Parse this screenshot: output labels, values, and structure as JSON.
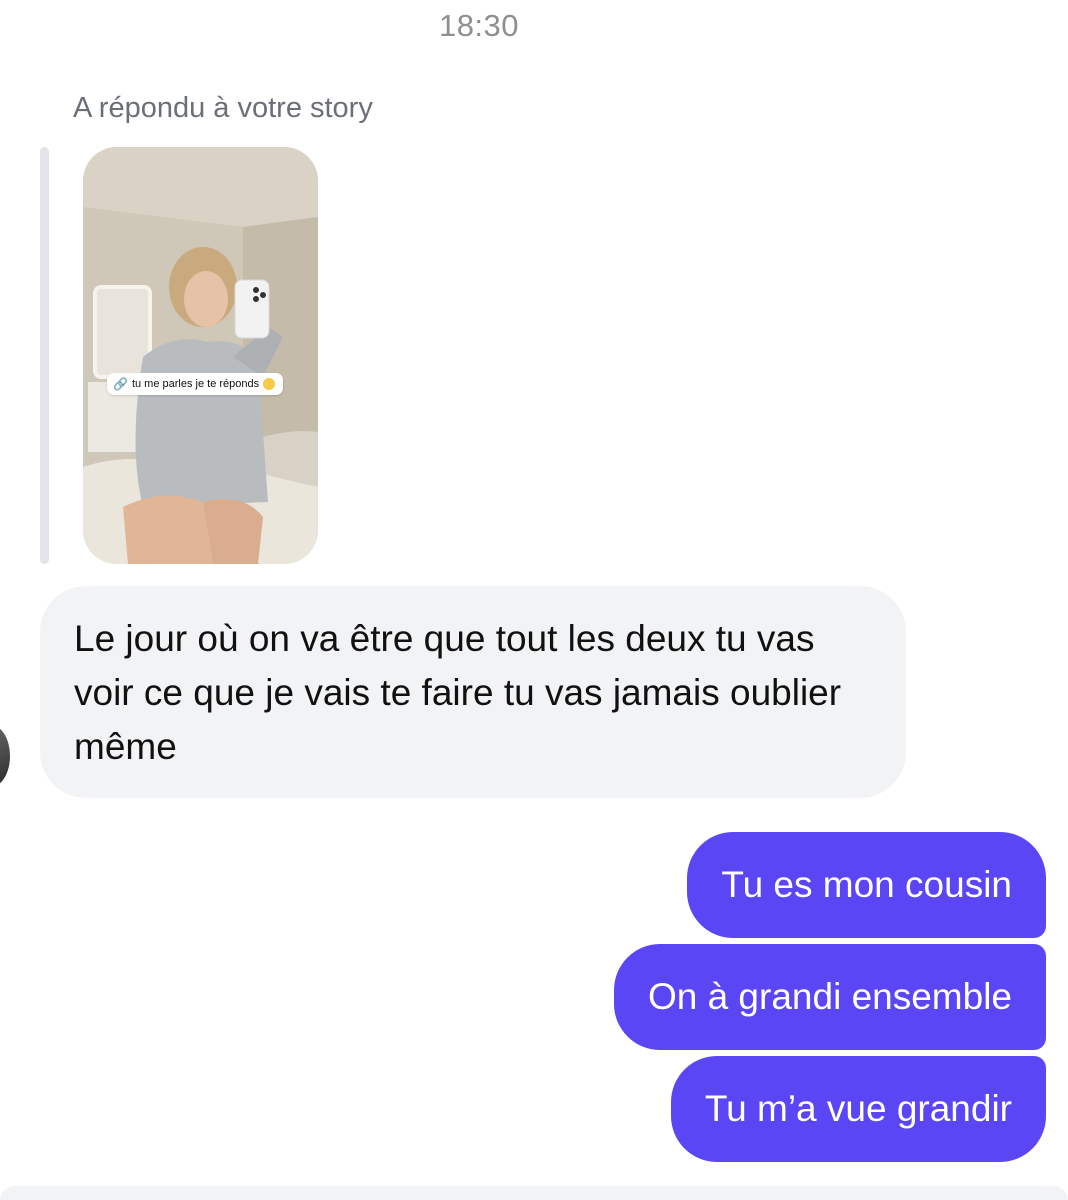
{
  "chat": {
    "timestamp": "18:30",
    "story_reply_note": "A répondu à votre story",
    "story": {
      "sticker_text": "tu me parles je te réponds",
      "sticker_link_icon": "link-icon",
      "sticker_emoji_icon": "smiling-face-emoji-icon"
    },
    "incoming_message": "Le jour où on va être que tout les deux tu vas voir ce que je vais te faire tu vas jamais oublier même",
    "outgoing_messages": [
      "Tu es mon cousin",
      "On à grandi ensemble",
      "Tu m’a vue grandir"
    ]
  },
  "colors": {
    "outgoing_bubble": "#5b46f5",
    "incoming_bubble": "#f2f3f5",
    "meta_text": "#8e8e93"
  }
}
